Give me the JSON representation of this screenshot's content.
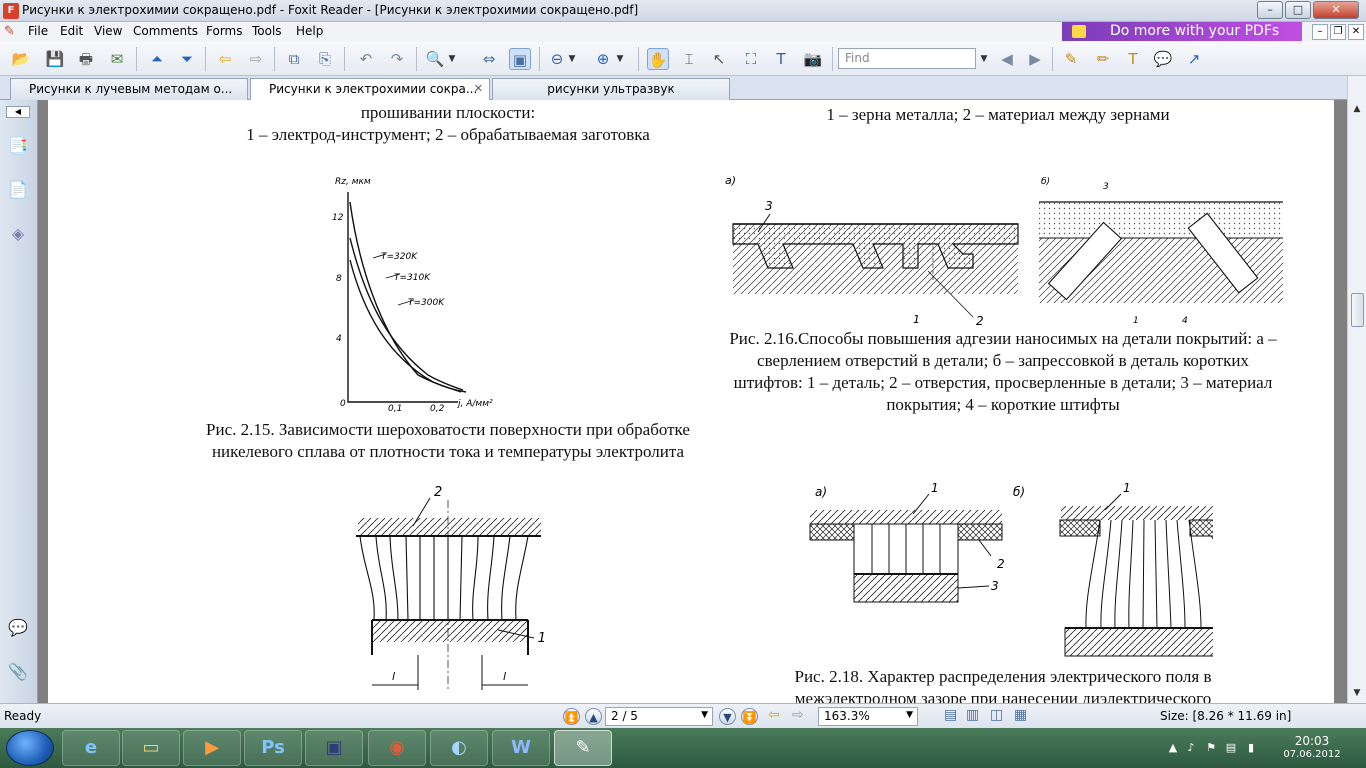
{
  "window": {
    "title": "Рисунки к электрохимии сокращено.pdf - Foxit Reader - [Рисунки к электрохимии сокращено.pdf]",
    "min_glyph": "–",
    "max_glyph": "□",
    "close_glyph": "✕"
  },
  "menu": {
    "items": [
      "File",
      "Edit",
      "View",
      "Comments",
      "Forms",
      "Tools",
      "Help"
    ],
    "promo": "Do more with your PDFs"
  },
  "toolbar": {
    "find_placeholder": "Find"
  },
  "tabs": [
    {
      "label": "Рисунки к лучевым методам о...",
      "active": false
    },
    {
      "label": "Рисунки к электрохимии сокра...",
      "active": true
    },
    {
      "label": "рисунки ультразвук",
      "active": false
    }
  ],
  "page": {
    "top_left_line1": "прошивании плоскости:",
    "top_left_line2": "1 – электрод-инструмент; 2 – обрабатываемая заготовка",
    "top_right_line": "1 – зерна металла; 2 – материал между зернами",
    "fig15_caption_line1": "Рис. 2.15. Зависимости шероховатости поверхности при обработке",
    "fig15_caption_line2": "никелевого сплава от плотности тока и температуры электролита",
    "fig16_caption": "Рис. 2.16.Способы повышения адгезии наносимых на детали покрытий: а – сверлением отверстий в детали; б – запрессовкой в деталь коротких штифтов: 1 – деталь; 2 – отверстия, просверленные в детали;  3 – материал покрытия; 4 – короткие штифты",
    "fig18_caption_line1": "Рис. 2.18. Характер распределения электрического поля в",
    "fig18_caption_line2": "межэлектродном зазоре при нанесении диэлектрического",
    "fig15_chart": {
      "ylabel": "Rz, мкм",
      "xlabel": "j, А/мм²",
      "y_ticks": [
        "12",
        "8",
        "4",
        "0"
      ],
      "x_ticks": [
        "0,1",
        "0,2"
      ],
      "curve_labels": [
        "T=320K",
        "T=310K",
        "T=300K"
      ]
    },
    "fig16_labels": {
      "a": "а)",
      "b": "б)",
      "n1": "1",
      "n2": "2",
      "n3": "3",
      "n4": "4"
    },
    "fig17_labels": {
      "n1": "1",
      "n2": "2",
      "l": "l"
    },
    "fig18_labels": {
      "a": "а)",
      "b": "б)",
      "n1": "1",
      "n2": "2",
      "n3": "3"
    }
  },
  "status": {
    "ready": "Ready",
    "page_indicator": "2 / 5",
    "zoom": "163.3%",
    "size": "Size: [8.26 * 11.69 in]"
  },
  "taskbar": {
    "time": "20:03",
    "date": "07.06.2012",
    "apps": [
      "ie",
      "explorer",
      "media",
      "Ps",
      "save",
      "chrome",
      "app",
      "W",
      "foxit"
    ]
  }
}
